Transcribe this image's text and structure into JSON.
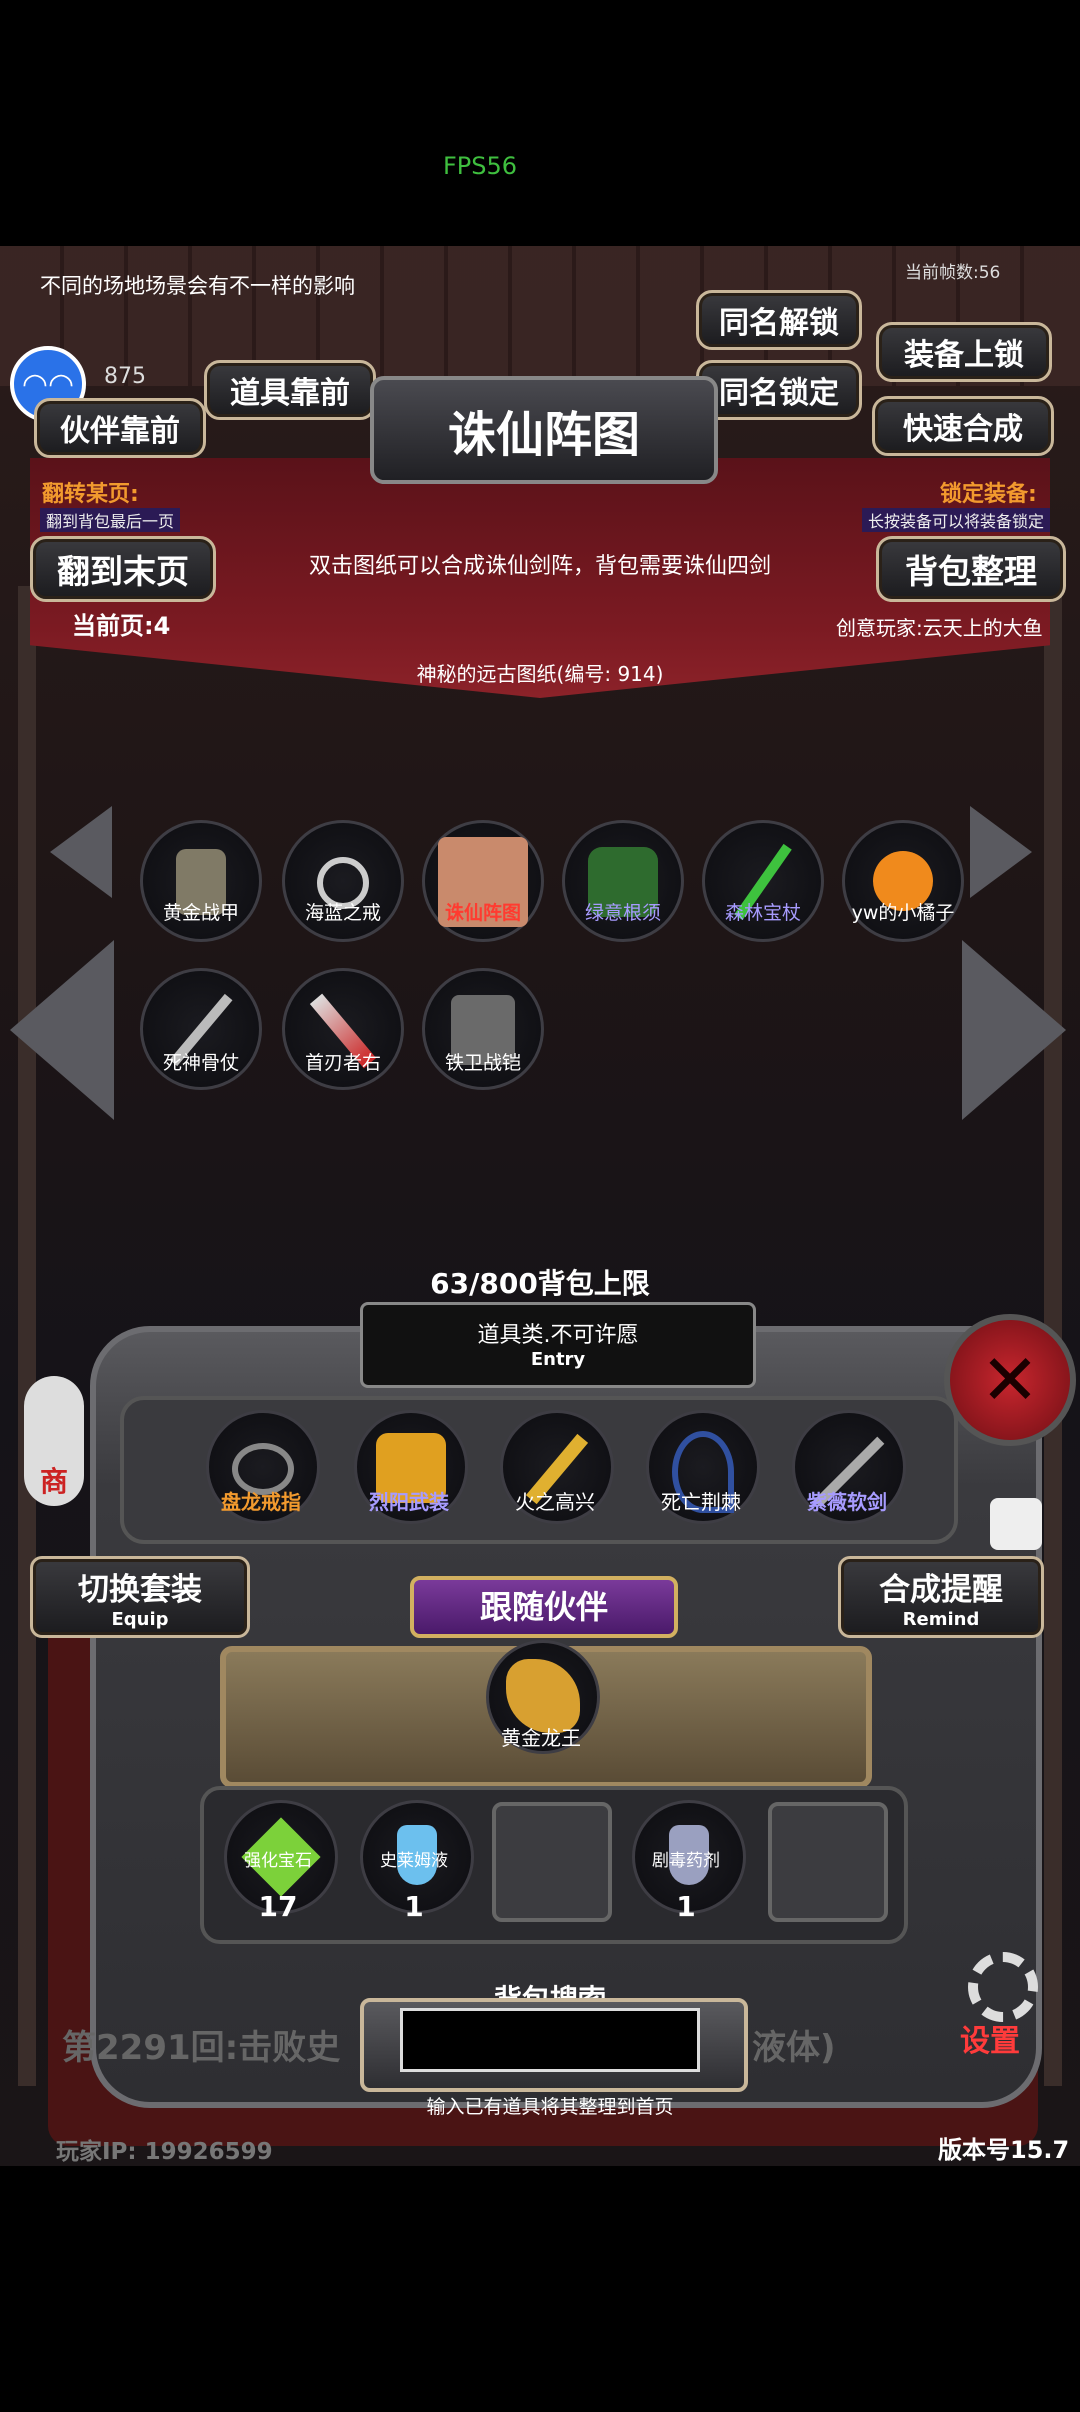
{
  "fps_overlay": "FPS56",
  "game": {
    "tip": "不同的场地场景会有不一样的影响",
    "frame_counter": "当前帧数:56",
    "coins": "875",
    "title": "诛仙阵图",
    "buttons": {
      "unlock_same": "同名解锁",
      "lock_same": "同名锁定",
      "equip_lock": "装备上锁",
      "quick_merge": "快速合成",
      "items_front": "道具靠前",
      "partner_front": "伙伴靠前",
      "last_page": "翻到末页",
      "bag_sort": "背包整理",
      "switch_set": "切换套装",
      "switch_set_en": "Equip",
      "merge_remind": "合成提醒",
      "merge_remind_en": "Remind",
      "settings": "设置",
      "shop": "商"
    },
    "flip_label": "翻转某页:",
    "flip_hint": "翻到背包最后一页",
    "lock_label": "锁定装备:",
    "lock_hint": "长按装备可以将装备锁定",
    "description": "双击图纸可以合成诛仙剑阵，背包需要诛仙四剑",
    "current_page": "当前页:4",
    "creator": "创意玩家:云天上的大鱼",
    "item_name": "神秘的远古图纸(编号:  914)",
    "grid_items": [
      {
        "name": "黄金战甲",
        "color": "#ffffff"
      },
      {
        "name": "海蓝之戒",
        "color": "#ffffff"
      },
      {
        "name": "诛仙阵图",
        "color": "#ff3b30"
      },
      {
        "name": "绿意根须",
        "color": "#a79bff"
      },
      {
        "name": "森林宝杖",
        "color": "#a79bff"
      },
      {
        "name": "yw的小橘子",
        "color": "#ffffff"
      },
      {
        "name": "死神骨仗",
        "color": "#ffffff"
      },
      {
        "name": "首刃者右",
        "color": "#ffffff"
      },
      {
        "name": "铁卫战铠",
        "color": "#ffffff"
      }
    ],
    "capacity": "63/800背包上限",
    "entry_text": "道具类.不可许愿",
    "entry_en": "Entry",
    "equipped": [
      {
        "name": "盘龙戒指",
        "color": "#f29a2e"
      },
      {
        "name": "烈阳武装",
        "color": "#a79bff"
      },
      {
        "name": "火之高兴",
        "color": "#ffffff"
      },
      {
        "name": "死亡荆棘",
        "color": "#ffffff"
      },
      {
        "name": "紫薇软剑",
        "color": "#a79bff"
      }
    ],
    "follow_title": "跟随伙伴",
    "partner": "黄金龙王",
    "consumables": [
      {
        "name": "强化宝石",
        "count": "17"
      },
      {
        "name": "史莱姆液",
        "count": "1"
      },
      {
        "name": "",
        "count": ""
      },
      {
        "name": "剧毒药剂",
        "count": "1"
      },
      {
        "name": "",
        "count": ""
      }
    ],
    "log": "第2291回:击败史",
    "log_tail": "液体)",
    "search_title": "背包搜索",
    "search_hint": "输入已有道具将其整理到首页",
    "player_ip": "玩家IP:  19926599",
    "version": "版本号15.7"
  }
}
